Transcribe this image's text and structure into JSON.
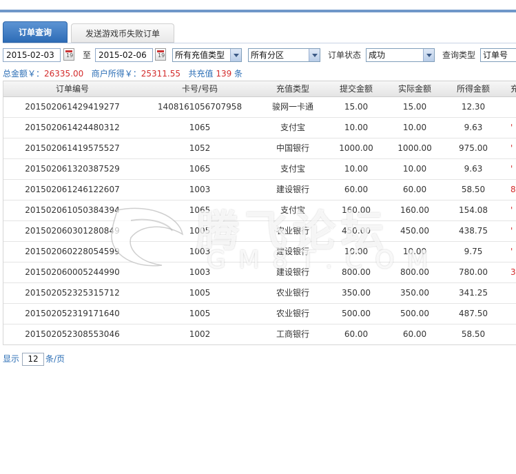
{
  "tabs": {
    "active": "订单查询",
    "inactive": "发送游戏币失败订单"
  },
  "filter": {
    "date_from": "2015-02-03",
    "to_label": "至",
    "date_to": "2015-02-06",
    "recharge_type": "所有充值类型",
    "region": "所有分区",
    "status_label": "订单状态",
    "status_value": "成功",
    "query_type_label": "查询类型",
    "query_type_value": "订单号"
  },
  "summary": {
    "total_label": "总金额￥：",
    "total_value": "26335.00",
    "merchant_label": "商户所得￥：",
    "merchant_value": "25311.55",
    "count_label": "共充值",
    "count_value": "139",
    "count_unit": "条"
  },
  "table": {
    "headers": [
      "订单编号",
      "卡号/号码",
      "充值类型",
      "提交金额",
      "实际金额",
      "所得金额",
      "充"
    ],
    "rows": [
      [
        "201502061429419277",
        "1408161056707958",
        "骏网一卡通",
        "15.00",
        "15.00",
        "12.30",
        ""
      ],
      [
        "201502061424480312",
        "1065",
        "支付宝",
        "10.00",
        "10.00",
        "9.63",
        "'"
      ],
      [
        "201502061419575527",
        "1052",
        "中国银行",
        "1000.00",
        "1000.00",
        "975.00",
        "'"
      ],
      [
        "201502061320387529",
        "1065",
        "支付宝",
        "10.00",
        "10.00",
        "9.63",
        "'"
      ],
      [
        "201502061246122607",
        "1003",
        "建设银行",
        "60.00",
        "60.00",
        "58.50",
        "8"
      ],
      [
        "201502061050384394",
        "1065",
        "支付宝",
        "160.00",
        "160.00",
        "154.08",
        "'"
      ],
      [
        "201502060301280849",
        "1005",
        "农业银行",
        "450.00",
        "450.00",
        "438.75",
        "'"
      ],
      [
        "201502060228054599",
        "1003",
        "建设银行",
        "10.00",
        "10.00",
        "9.75",
        "'"
      ],
      [
        "201502060005244990",
        "1003",
        "建设银行",
        "800.00",
        "800.00",
        "780.00",
        "3"
      ],
      [
        "201502052325315712",
        "1005",
        "农业银行",
        "350.00",
        "350.00",
        "341.25",
        ""
      ],
      [
        "201502052319171640",
        "1005",
        "农业银行",
        "500.00",
        "500.00",
        "487.50",
        ""
      ],
      [
        "201502052308553046",
        "1002",
        "工商银行",
        "60.00",
        "60.00",
        "58.50",
        ""
      ]
    ]
  },
  "pager": {
    "show_label": "显示",
    "page_size": "12",
    "per_page_label": "条/页"
  },
  "watermark": {
    "text": "腾飞论坛",
    "sub": "GM8T.COM"
  },
  "colors": {
    "accent": "#2d6cb6",
    "value_red": "#d32a2a",
    "label_blue": "#2a6db5"
  }
}
